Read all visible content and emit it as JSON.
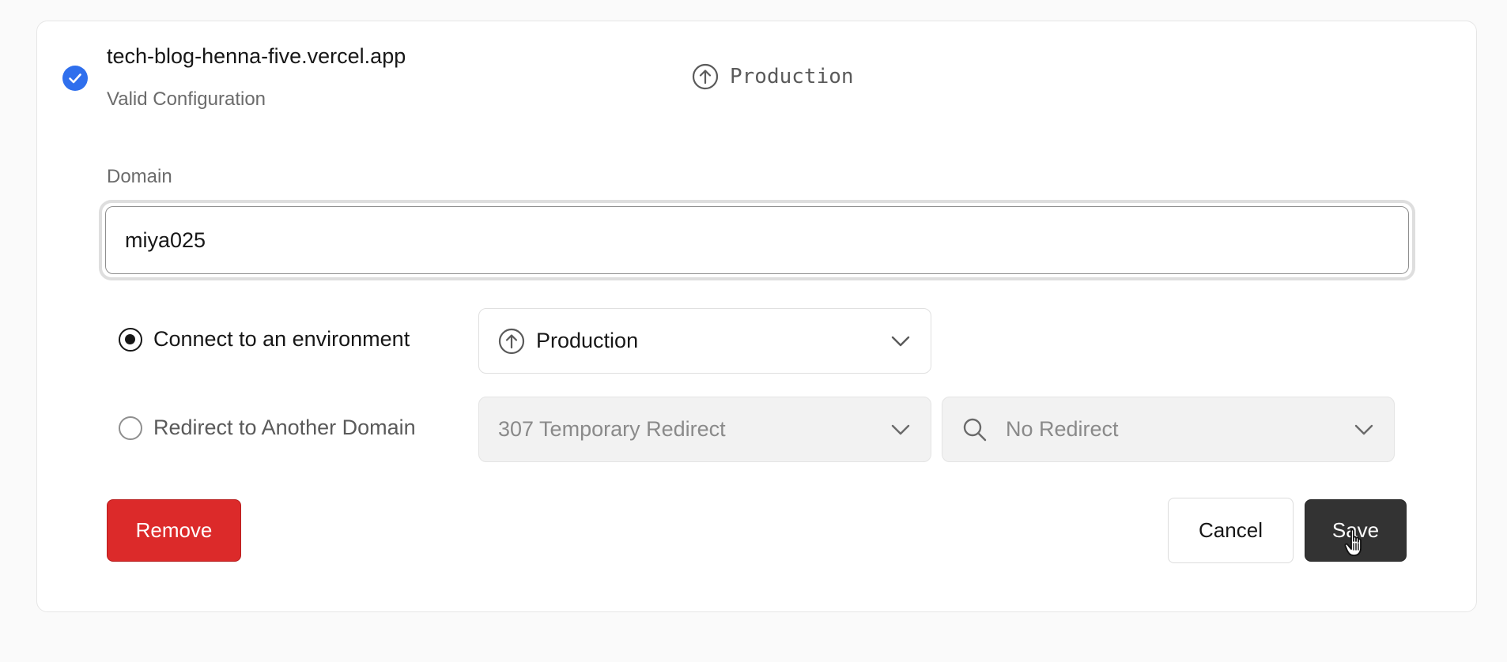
{
  "domain_card": {
    "domain": "tech-blog-henna-five.vercel.app",
    "status": "Valid Configuration",
    "environment_tag": "Production"
  },
  "form": {
    "domain_label": "Domain",
    "domain_value": "miya025",
    "connect_option": {
      "label": "Connect to an environment",
      "selected": true,
      "environment_select": {
        "value": "Production",
        "icon": "arrow-up-circle-icon"
      }
    },
    "redirect_option": {
      "label": "Redirect to Another Domain",
      "selected": false,
      "status_select": {
        "value": "307 Temporary Redirect"
      },
      "target_select": {
        "value": "No Redirect",
        "icon": "search-icon"
      }
    }
  },
  "actions": {
    "remove_label": "Remove",
    "cancel_label": "Cancel",
    "save_label": "Save"
  },
  "colors": {
    "accent_blue": "#2f6fed",
    "danger": "#dc2a2a",
    "primary_dark": "#333333"
  }
}
